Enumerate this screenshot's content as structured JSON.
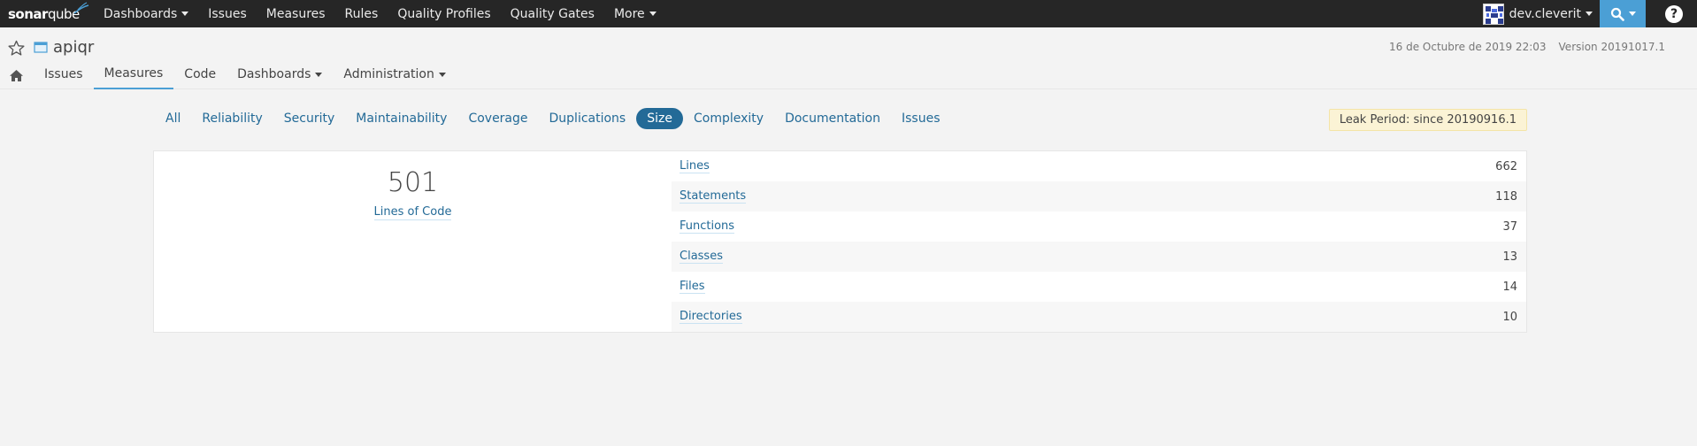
{
  "app": {
    "logo_main": "sonar",
    "logo_sub": "qube"
  },
  "global_nav": {
    "items": [
      {
        "label": "Dashboards",
        "dropdown": true
      },
      {
        "label": "Issues",
        "dropdown": false
      },
      {
        "label": "Measures",
        "dropdown": false
      },
      {
        "label": "Rules",
        "dropdown": false
      },
      {
        "label": "Quality Profiles",
        "dropdown": false
      },
      {
        "label": "Quality Gates",
        "dropdown": false
      },
      {
        "label": "More",
        "dropdown": true
      }
    ],
    "user": "dev.cleverit",
    "search_icon": "search-icon",
    "help_icon": "help-icon"
  },
  "project": {
    "name": "apiqr",
    "analysis_date": "16 de Octubre de 2019 22:03",
    "version": "Version 20191017.1"
  },
  "context_nav": {
    "items": [
      {
        "label": "Issues",
        "dropdown": false,
        "active": false
      },
      {
        "label": "Measures",
        "dropdown": false,
        "active": true
      },
      {
        "label": "Code",
        "dropdown": false,
        "active": false
      },
      {
        "label": "Dashboards",
        "dropdown": true,
        "active": false
      },
      {
        "label": "Administration",
        "dropdown": true,
        "active": false
      }
    ]
  },
  "domain_tabs": [
    {
      "label": "All",
      "active": false
    },
    {
      "label": "Reliability",
      "active": false
    },
    {
      "label": "Security",
      "active": false
    },
    {
      "label": "Maintainability",
      "active": false
    },
    {
      "label": "Coverage",
      "active": false
    },
    {
      "label": "Duplications",
      "active": false
    },
    {
      "label": "Size",
      "active": true
    },
    {
      "label": "Complexity",
      "active": false
    },
    {
      "label": "Documentation",
      "active": false
    },
    {
      "label": "Issues",
      "active": false
    }
  ],
  "leak_period": "Leak Period: since 20190916.1",
  "main_measure": {
    "value": "501",
    "label": "Lines of Code"
  },
  "measures": [
    {
      "label": "Lines",
      "value": "662"
    },
    {
      "label": "Statements",
      "value": "118"
    },
    {
      "label": "Functions",
      "value": "37"
    },
    {
      "label": "Classes",
      "value": "13"
    },
    {
      "label": "Files",
      "value": "14"
    },
    {
      "label": "Directories",
      "value": "10"
    }
  ],
  "colors": {
    "topbar": "#262626",
    "accent": "#4b9fd5",
    "link": "#236a97",
    "leak_bg": "#fbf3d5"
  }
}
